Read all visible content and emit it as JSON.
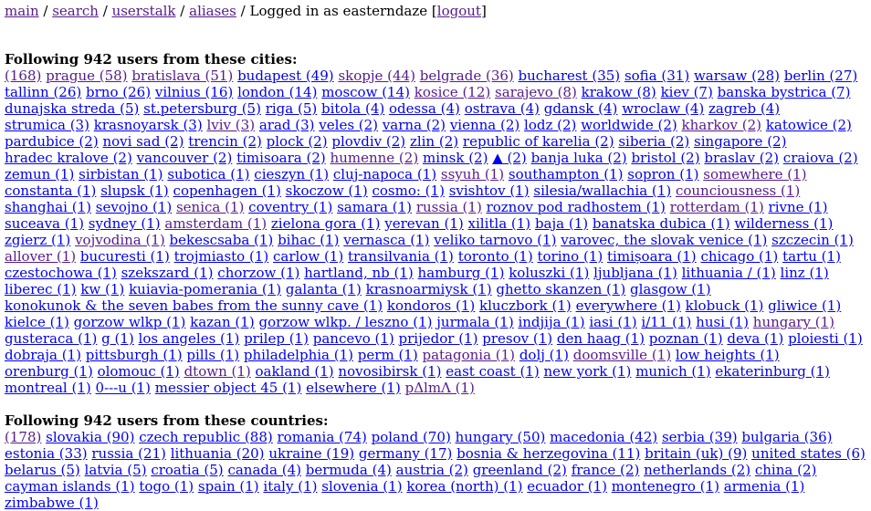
{
  "nav": {
    "main": "main",
    "search": "search",
    "userstalk": "userstalk",
    "aliases": "aliases",
    "sep": " / ",
    "logged_in": "Logged in as easterndaze",
    "logout": "logout"
  },
  "colors": {
    "link": "#0000ee",
    "visited": "#551a8b"
  },
  "cities": {
    "heading": "Following 942 users from these cities:",
    "items": [
      {
        "t": "(168)",
        "v": 1
      },
      {
        "t": "prague (58)",
        "v": 1
      },
      {
        "t": "bratislava (51)",
        "v": 1
      },
      {
        "t": "budapest (49)",
        "v": 0
      },
      {
        "t": "skopje (44)",
        "v": 1
      },
      {
        "t": "belgrade (36)",
        "v": 1
      },
      {
        "t": "bucharest (35)",
        "v": 0
      },
      {
        "t": "sofia (31)",
        "v": 0
      },
      {
        "t": "warsaw (28)",
        "v": 0
      },
      {
        "t": "berlin (27)",
        "v": 0
      },
      {
        "t": "tallinn (26)",
        "v": 0
      },
      {
        "t": "brno (26)",
        "v": 0
      },
      {
        "t": "vilnius (16)",
        "v": 0
      },
      {
        "t": "london (14)",
        "v": 0
      },
      {
        "t": "moscow (14)",
        "v": 0
      },
      {
        "t": "kosice (12)",
        "v": 1
      },
      {
        "t": "sarajevo (8)",
        "v": 1
      },
      {
        "t": "krakow (8)",
        "v": 0
      },
      {
        "t": "kiev (7)",
        "v": 0
      },
      {
        "t": "banska bystrica (7)",
        "v": 0
      },
      {
        "t": "dunajska streda (5)",
        "v": 0
      },
      {
        "t": "st.petersburg (5)",
        "v": 0
      },
      {
        "t": "riga (5)",
        "v": 0
      },
      {
        "t": "bitola (4)",
        "v": 0
      },
      {
        "t": "odessa (4)",
        "v": 0
      },
      {
        "t": "ostrava (4)",
        "v": 0
      },
      {
        "t": "gdansk (4)",
        "v": 0
      },
      {
        "t": "wroclaw (4)",
        "v": 0
      },
      {
        "t": "zagreb (4)",
        "v": 0
      },
      {
        "t": "strumica (3)",
        "v": 0
      },
      {
        "t": "krasnoyarsk (3)",
        "v": 0
      },
      {
        "t": "lviv (3)",
        "v": 1
      },
      {
        "t": "arad (3)",
        "v": 0
      },
      {
        "t": "veles (2)",
        "v": 0
      },
      {
        "t": "varna (2)",
        "v": 0
      },
      {
        "t": "vienna (2)",
        "v": 0
      },
      {
        "t": "lodz (2)",
        "v": 0
      },
      {
        "t": "worldwide (2)",
        "v": 0
      },
      {
        "t": "kharkov (2)",
        "v": 1
      },
      {
        "t": "katowice (2)",
        "v": 0
      },
      {
        "t": "pardubice (2)",
        "v": 0
      },
      {
        "t": "novi sad (2)",
        "v": 0
      },
      {
        "t": "trencin (2)",
        "v": 0
      },
      {
        "t": "plock (2)",
        "v": 0
      },
      {
        "t": "plovdiv (2)",
        "v": 0
      },
      {
        "t": "zlin (2)",
        "v": 0
      },
      {
        "t": "republic of karelia (2)",
        "v": 0
      },
      {
        "t": "siberia (2)",
        "v": 0
      },
      {
        "t": "singapore (2)",
        "v": 0
      },
      {
        "t": "hradec kralove (2)",
        "v": 0
      },
      {
        "t": "vancouver (2)",
        "v": 0
      },
      {
        "t": "timisoara (2)",
        "v": 0
      },
      {
        "t": "humenne (2)",
        "v": 1
      },
      {
        "t": "minsk (2)",
        "v": 0
      },
      {
        "t": "▲ (2)",
        "v": 0
      },
      {
        "t": "banja luka (2)",
        "v": 0
      },
      {
        "t": "bristol (2)",
        "v": 0
      },
      {
        "t": "braslav (2)",
        "v": 0
      },
      {
        "t": "craiova (2)",
        "v": 0
      },
      {
        "t": "zemun (1)",
        "v": 0
      },
      {
        "t": "sirbistan (1)",
        "v": 0
      },
      {
        "t": "subotica (1)",
        "v": 0
      },
      {
        "t": "cieszyn (1)",
        "v": 0
      },
      {
        "t": "cluj-napoca (1)",
        "v": 0
      },
      {
        "t": "ssyuh (1)",
        "v": 1
      },
      {
        "t": "southampton (1)",
        "v": 0
      },
      {
        "t": "sopron (1)",
        "v": 0
      },
      {
        "t": "somewhere (1)",
        "v": 1
      },
      {
        "t": "constanta (1)",
        "v": 0
      },
      {
        "t": "slupsk (1)",
        "v": 0
      },
      {
        "t": "copenhagen (1)",
        "v": 0
      },
      {
        "t": "skoczow (1)",
        "v": 0
      },
      {
        "t": "cosmo: (1)",
        "v": 0
      },
      {
        "t": "svishtov (1)",
        "v": 0
      },
      {
        "t": "silesia/wallachia (1)",
        "v": 0
      },
      {
        "t": "counciousness (1)",
        "v": 1
      },
      {
        "t": "shanghai (1)",
        "v": 0
      },
      {
        "t": "sevojno (1)",
        "v": 0
      },
      {
        "t": "senica (1)",
        "v": 1
      },
      {
        "t": "coventry (1)",
        "v": 0
      },
      {
        "t": "samara (1)",
        "v": 0
      },
      {
        "t": "russia (1)",
        "v": 1
      },
      {
        "t": "roznov pod radhostem (1)",
        "v": 0
      },
      {
        "t": "rotterdam (1)",
        "v": 1
      },
      {
        "t": "rivne (1)",
        "v": 0
      },
      {
        "t": "suceava (1)",
        "v": 0
      },
      {
        "t": "sydney (1)",
        "v": 0
      },
      {
        "t": "amsterdam (1)",
        "v": 1
      },
      {
        "t": "zielona gora (1)",
        "v": 0
      },
      {
        "t": "yerevan (1)",
        "v": 0
      },
      {
        "t": "xilitla (1)",
        "v": 0
      },
      {
        "t": "baja (1)",
        "v": 0
      },
      {
        "t": "banatska dubica (1)",
        "v": 0
      },
      {
        "t": "wilderness (1)",
        "v": 0
      },
      {
        "t": "zgierz (1)",
        "v": 0
      },
      {
        "t": "vojvodina (1)",
        "v": 1
      },
      {
        "t": "bekescsaba (1)",
        "v": 0
      },
      {
        "t": "bihac (1)",
        "v": 0
      },
      {
        "t": "vernasca (1)",
        "v": 0
      },
      {
        "t": "veliko tarnovo (1)",
        "v": 0
      },
      {
        "t": "varovec, the slovak venice (1)",
        "v": 0
      },
      {
        "t": "szczecin (1)",
        "v": 0
      },
      {
        "t": "allover (1)",
        "v": 1
      },
      {
        "t": "bucuresti (1)",
        "v": 0
      },
      {
        "t": "trojmiasto (1)",
        "v": 0
      },
      {
        "t": "carlow (1)",
        "v": 0
      },
      {
        "t": "transilvania (1)",
        "v": 0
      },
      {
        "t": "toronto (1)",
        "v": 0
      },
      {
        "t": "torino (1)",
        "v": 0
      },
      {
        "t": "timișoara (1)",
        "v": 0
      },
      {
        "t": "chicago (1)",
        "v": 0
      },
      {
        "t": "tartu (1)",
        "v": 0
      },
      {
        "t": "czestochowa (1)",
        "v": 0
      },
      {
        "t": "szekszard (1)",
        "v": 0
      },
      {
        "t": "chorzow (1)",
        "v": 0
      },
      {
        "t": "hartland, nb (1)",
        "v": 0
      },
      {
        "t": "hamburg (1)",
        "v": 0
      },
      {
        "t": "koluszki (1)",
        "v": 0
      },
      {
        "t": "ljubljana (1)",
        "v": 0
      },
      {
        "t": "lithuania / (1)",
        "v": 0
      },
      {
        "t": "linz (1)",
        "v": 0
      },
      {
        "t": "liberec (1)",
        "v": 0
      },
      {
        "t": "kw (1)",
        "v": 0
      },
      {
        "t": "kuiavia-pomerania (1)",
        "v": 0
      },
      {
        "t": "galanta (1)",
        "v": 0
      },
      {
        "t": "krasnoarmiysk (1)",
        "v": 0
      },
      {
        "t": "ghetto skanzen (1)",
        "v": 0
      },
      {
        "t": "glasgow (1)",
        "v": 0
      },
      {
        "t": "konokunok & the seven babes from the sunny cave (1)",
        "v": 0
      },
      {
        "t": "kondoros (1)",
        "v": 0
      },
      {
        "t": "kluczbork (1)",
        "v": 0
      },
      {
        "t": "everywhere (1)",
        "v": 0
      },
      {
        "t": "klobuck (1)",
        "v": 0
      },
      {
        "t": "gliwice (1)",
        "v": 0
      },
      {
        "t": "kielce (1)",
        "v": 0
      },
      {
        "t": "gorzow wlkp (1)",
        "v": 0
      },
      {
        "t": "kazan (1)",
        "v": 0
      },
      {
        "t": "gorzow wlkp. / leszno (1)",
        "v": 0
      },
      {
        "t": "jurmala (1)",
        "v": 0
      },
      {
        "t": "indjija (1)",
        "v": 0
      },
      {
        "t": "iasi (1)",
        "v": 0
      },
      {
        "t": "i/11 (1)",
        "v": 0
      },
      {
        "t": "husi (1)",
        "v": 0
      },
      {
        "t": "hungary (1)",
        "v": 1
      },
      {
        "t": "gusteraca (1)",
        "v": 0
      },
      {
        "t": "g (1)",
        "v": 0
      },
      {
        "t": "los angeles (1)",
        "v": 0
      },
      {
        "t": "prilep (1)",
        "v": 0
      },
      {
        "t": "pancevo (1)",
        "v": 0
      },
      {
        "t": "prijedor (1)",
        "v": 0
      },
      {
        "t": "presov (1)",
        "v": 0
      },
      {
        "t": "den haag (1)",
        "v": 0
      },
      {
        "t": "poznan (1)",
        "v": 0
      },
      {
        "t": "deva (1)",
        "v": 0
      },
      {
        "t": "ploiesti (1)",
        "v": 0
      },
      {
        "t": "dobraja (1)",
        "v": 0
      },
      {
        "t": "pittsburgh (1)",
        "v": 0
      },
      {
        "t": "pills (1)",
        "v": 0
      },
      {
        "t": "philadelphia (1)",
        "v": 0
      },
      {
        "t": "perm (1)",
        "v": 0
      },
      {
        "t": "patagonia (1)",
        "v": 1
      },
      {
        "t": "dolj (1)",
        "v": 0
      },
      {
        "t": "doomsville (1)",
        "v": 1
      },
      {
        "t": "low heights (1)",
        "v": 0
      },
      {
        "t": "orenburg (1)",
        "v": 0
      },
      {
        "t": "olomouc (1)",
        "v": 0
      },
      {
        "t": "dtown (1)",
        "v": 1
      },
      {
        "t": "oakland (1)",
        "v": 0
      },
      {
        "t": "novosibirsk (1)",
        "v": 0
      },
      {
        "t": "east coast (1)",
        "v": 0
      },
      {
        "t": "new york (1)",
        "v": 0
      },
      {
        "t": "munich (1)",
        "v": 0
      },
      {
        "t": "ekaterinburg (1)",
        "v": 0
      },
      {
        "t": "montreal (1)",
        "v": 0
      },
      {
        "t": "0---u (1)",
        "v": 0
      },
      {
        "t": "messier object 45 (1)",
        "v": 0
      },
      {
        "t": "elsewhere (1)",
        "v": 0
      },
      {
        "t": "pΔlmΛ (1)",
        "v": 1
      }
    ]
  },
  "countries": {
    "heading": "Following 942 users from these countries:",
    "items": [
      {
        "t": "(178)",
        "v": 1
      },
      {
        "t": "slovakia (90)",
        "v": 0
      },
      {
        "t": "czech republic (88)",
        "v": 0
      },
      {
        "t": "romania (74)",
        "v": 0
      },
      {
        "t": "poland (70)",
        "v": 0
      },
      {
        "t": "hungary (50)",
        "v": 0
      },
      {
        "t": "macedonia (42)",
        "v": 0
      },
      {
        "t": "serbia (39)",
        "v": 0
      },
      {
        "t": "bulgaria (36)",
        "v": 0
      },
      {
        "t": "estonia (33)",
        "v": 0
      },
      {
        "t": "russia (21)",
        "v": 0
      },
      {
        "t": "lithuania (20)",
        "v": 0
      },
      {
        "t": "ukraine (19)",
        "v": 0
      },
      {
        "t": "germany (17)",
        "v": 0
      },
      {
        "t": "bosnia & herzegovina (11)",
        "v": 0
      },
      {
        "t": "britain (uk) (9)",
        "v": 0
      },
      {
        "t": "united states (6)",
        "v": 0
      },
      {
        "t": "belarus (5)",
        "v": 0
      },
      {
        "t": "latvia (5)",
        "v": 0
      },
      {
        "t": "croatia (5)",
        "v": 0
      },
      {
        "t": "canada (4)",
        "v": 0
      },
      {
        "t": "bermuda (4)",
        "v": 0
      },
      {
        "t": "austria (2)",
        "v": 0
      },
      {
        "t": "greenland (2)",
        "v": 0
      },
      {
        "t": "france (2)",
        "v": 0
      },
      {
        "t": "netherlands (2)",
        "v": 0
      },
      {
        "t": "china (2)",
        "v": 0
      },
      {
        "t": "cayman islands (1)",
        "v": 0
      },
      {
        "t": "togo (1)",
        "v": 0
      },
      {
        "t": "spain (1)",
        "v": 0
      },
      {
        "t": "italy (1)",
        "v": 0
      },
      {
        "t": "slovenia (1)",
        "v": 0
      },
      {
        "t": "korea (north) (1)",
        "v": 0
      },
      {
        "t": "ecuador (1)",
        "v": 0
      },
      {
        "t": "montenegro (1)",
        "v": 0
      },
      {
        "t": "armenia (1)",
        "v": 0
      },
      {
        "t": "zimbabwe (1)",
        "v": 0
      }
    ]
  }
}
